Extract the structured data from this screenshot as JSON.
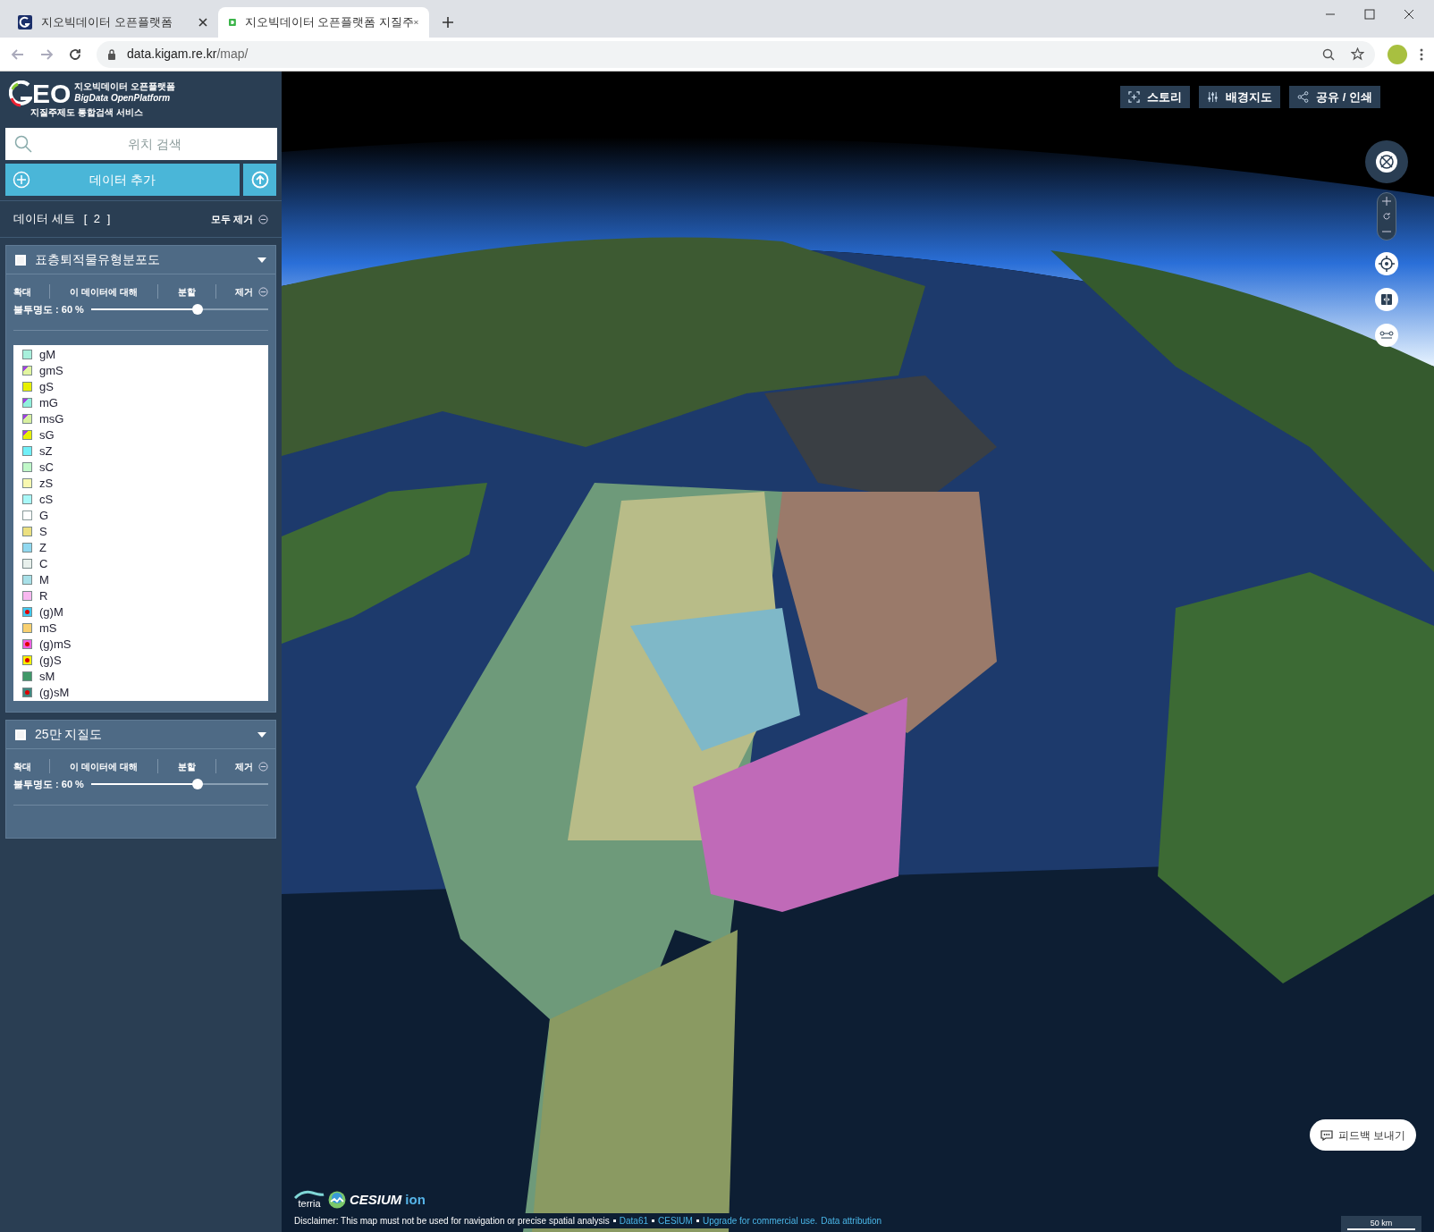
{
  "browser": {
    "tabs": [
      {
        "title": "지오빅데이터 오픈플랫폼",
        "selected": false
      },
      {
        "title": "지오빅데이터 오픈플랫폼 지질주",
        "selected": true
      }
    ],
    "address": {
      "host": "data.kigam.re.kr",
      "path": "/map/"
    }
  },
  "sidebar": {
    "logo": {
      "mark": "EO",
      "title": "지오빅데이터 오픈플랫폼",
      "subtitle": "BigData OpenPlatform",
      "service": "지질주제도 통합검색 서비스"
    },
    "search": {
      "placeholder": "위치 검색"
    },
    "add_button": "데이터 추가",
    "dataset_header": {
      "title": "데이터 세트",
      "count": "[ 2 ]",
      "remove_all": "모두 제거"
    },
    "datasets": [
      {
        "title": "표층퇴적물유형분포도",
        "checked": false,
        "expanded": true,
        "actions": [
          "확대",
          "이 데이터에 대해",
          "분할",
          "제거"
        ],
        "opacity_label": "불투명도 : 60 %",
        "level": 0.6,
        "legend": [
          {
            "label": "gM",
            "kind": "fill",
            "color": "#a8f0dc"
          },
          {
            "label": "gmS",
            "kind": "corner",
            "color": "#e2f5a0"
          },
          {
            "label": "gS",
            "kind": "fill",
            "color": "#e8f000"
          },
          {
            "label": "mG",
            "kind": "corner",
            "color": "#90f0dc"
          },
          {
            "label": "msG",
            "kind": "corner",
            "color": "#d8f0a0"
          },
          {
            "label": "sG",
            "kind": "corner",
            "color": "#e8f000"
          },
          {
            "label": "sZ",
            "kind": "fill",
            "color": "#70f0f8"
          },
          {
            "label": "sC",
            "kind": "fill",
            "color": "#c0f8c8"
          },
          {
            "label": "zS",
            "kind": "fill",
            "color": "#f8f8b0"
          },
          {
            "label": "cS",
            "kind": "fill",
            "color": "#a8f8f8"
          },
          {
            "label": "G",
            "kind": "outline",
            "color": "#ffffff"
          },
          {
            "label": "S",
            "kind": "fill",
            "color": "#ece080"
          },
          {
            "label": "Z",
            "kind": "fill",
            "color": "#90d8f0"
          },
          {
            "label": "C",
            "kind": "fill",
            "color": "#e8f0ec"
          },
          {
            "label": "M",
            "kind": "fill",
            "color": "#a8e0e8"
          },
          {
            "label": "R",
            "kind": "fill",
            "color": "#f8b8f0"
          },
          {
            "label": "(g)M",
            "kind": "dot",
            "color": "#40c8f0"
          },
          {
            "label": "mS",
            "kind": "fill",
            "color": "#f8d070"
          },
          {
            "label": "(g)mS",
            "kind": "dot",
            "color": "#f060e0"
          },
          {
            "label": "(g)S",
            "kind": "dot",
            "color": "#f8f000"
          },
          {
            "label": "sM",
            "kind": "fill",
            "color": "#409868"
          },
          {
            "label": "(g)sM",
            "kind": "dot",
            "color": "#408880"
          }
        ]
      },
      {
        "title": "25만 지질도",
        "checked": false,
        "expanded": true,
        "actions": [
          "확대",
          "이 데이터에 대해",
          "분할",
          "제거"
        ],
        "opacity_label": "불투명도 : 60 %",
        "level": 0.6
      }
    ]
  },
  "map": {
    "toolbar": [
      "스토리",
      "배경지도",
      "공유 / 인쇄"
    ],
    "feedback_button": "피드백 보내기",
    "brand": {
      "terria": "terria",
      "cesium": "CESIUM",
      "ion": "ion"
    },
    "disclaimer": "Disclaimer: This map must not be used for navigation or precise spatial analysis",
    "links": [
      "Data61",
      "CESIUM",
      "Upgrade for commercial use.",
      "Data attribution"
    ],
    "scale": "50 km"
  }
}
